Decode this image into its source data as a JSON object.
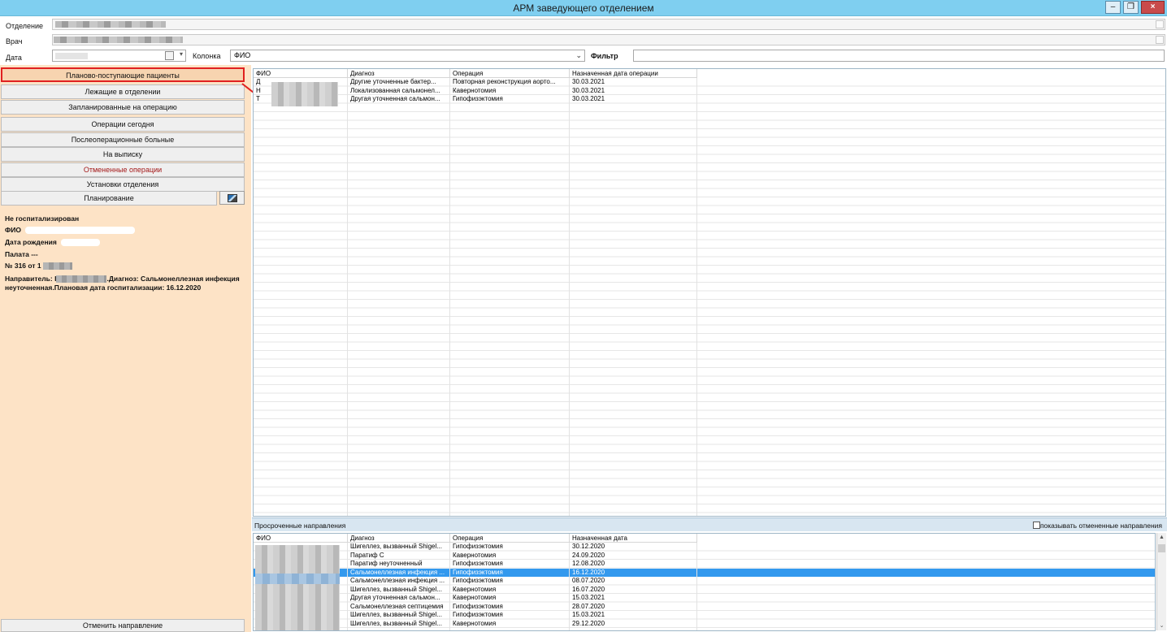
{
  "window": {
    "title": "АРМ заведующего отделением",
    "minimize": "‒",
    "restore": "❐",
    "close": "×"
  },
  "form": {
    "department_label": "Отделение",
    "doctor_label": "Врач",
    "date_label": "Дата",
    "column_label": "Колонка",
    "column_value": "ФИО",
    "filter_label": "Фильтр"
  },
  "nav": {
    "items": [
      {
        "label": "Планово-поступающие пациенты"
      },
      {
        "label": "Лежащие в отделении"
      },
      {
        "label": "Запланированные на операцию"
      },
      {
        "label": "Операции сегодня"
      },
      {
        "label": "Послеоперационные больные"
      },
      {
        "label": "На выписку"
      },
      {
        "label": "Отмененные операции"
      },
      {
        "label": "Установки отделения"
      },
      {
        "label": "Планирование"
      }
    ],
    "cancel_referral": "Отменить направление"
  },
  "patient_info": {
    "status": "Не госпитализирован",
    "fio_label": "ФИО",
    "birth_label": "Дата рождения",
    "ward": "Палата ---",
    "number_prefix": "№ 316 от 1",
    "referral_prefix": "Направитель: I",
    "referral_rest": ".Диагноз: Сальмонеллезная инфекция неуточненная.Плановая дата госпитализации: 16.12.2020"
  },
  "main_grid": {
    "columns": [
      "ФИО",
      "Диагноз",
      "Операция",
      "Назначенная дата операции"
    ],
    "rows": [
      [
        "Д",
        "Другие уточненные бактер...",
        "Повторная реконструкция аорто...",
        "30.03.2021"
      ],
      [
        "Н",
        "Локализованная сальмонел...",
        "Кавернотомия",
        "30.03.2021"
      ],
      [
        "Т",
        "Другая уточненная сальмон...",
        "Гипофизэктомия",
        "30.03.2021"
      ]
    ]
  },
  "overdue": {
    "title": "Просроченные направления",
    "show_cancelled": "показывать отмененные направления",
    "columns": [
      "ФИО",
      "Диагноз",
      "Операция",
      "Назначенная дата"
    ],
    "rows": [
      [
        "",
        "Шигеллез, вызванный Shigel...",
        "Гипофизэктомия",
        "30.12.2020"
      ],
      [
        "",
        "Паратиф С",
        "Кавернотомия",
        "24.09.2020"
      ],
      [
        "",
        "Паратиф неуточненный",
        "Гипофизэктомия",
        "12.08.2020"
      ],
      [
        "",
        "Сальмонеллезная инфекция ...",
        "Гипофизэктомия",
        "16.12.2020"
      ],
      [
        "",
        "Сальмонеллезная инфекция ...",
        "Гипофизэктомия",
        "08.07.2020"
      ],
      [
        "",
        "Шигеллез, вызванный Shigel...",
        "Кавернотомия",
        "16.07.2020"
      ],
      [
        "",
        "Другая уточненная сальмон...",
        "Кавернотомия",
        "15.03.2021"
      ],
      [
        "",
        "Сальмонеллезная септицемия",
        "Гипофизэктомия",
        "28.07.2020"
      ],
      [
        "",
        "Шигеллез, вызванный Shigel...",
        "Гипофизэктомия",
        "15.03.2021"
      ],
      [
        "",
        "Шигеллез, вызванный Shigel...",
        "Кавернотомия",
        "29.12.2020"
      ]
    ],
    "selected_index": 3
  }
}
